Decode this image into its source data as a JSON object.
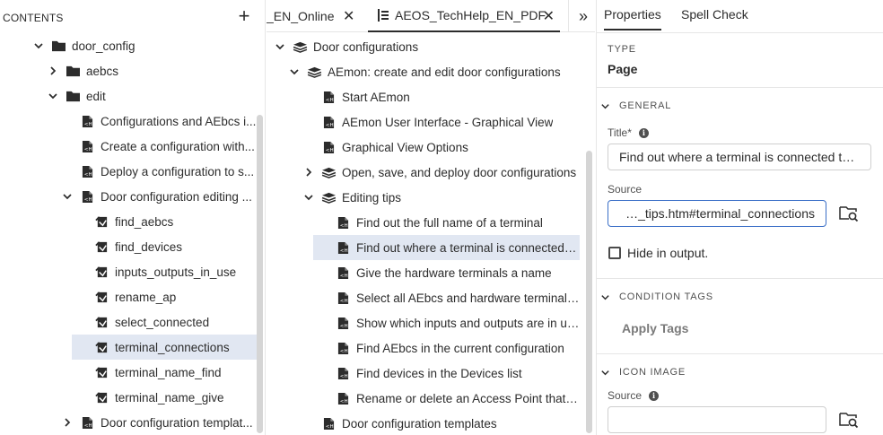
{
  "left": {
    "title": "CONTENTS",
    "add_label": "+",
    "tree": [
      {
        "label": "door_config",
        "kind": "folder",
        "state": "open",
        "level": 0
      },
      {
        "label": "aebcs",
        "kind": "folder",
        "state": "closed",
        "level": 1
      },
      {
        "label": "edit",
        "kind": "folder",
        "state": "open",
        "level": 1
      },
      {
        "label": "Configurations and AEbcs i...",
        "kind": "topic",
        "state": "none",
        "level": 2
      },
      {
        "label": "Create a configuration with...",
        "kind": "topic",
        "state": "none",
        "level": 2
      },
      {
        "label": "Deploy a configuration to s...",
        "kind": "topic",
        "state": "none",
        "level": 2
      },
      {
        "label": "Door configuration editing ...",
        "kind": "topic",
        "state": "open",
        "level": 2
      },
      {
        "label": "find_aebcs",
        "kind": "snippet",
        "state": "none",
        "level": 3
      },
      {
        "label": "find_devices",
        "kind": "snippet",
        "state": "none",
        "level": 3
      },
      {
        "label": "inputs_outputs_in_use",
        "kind": "snippet",
        "state": "none",
        "level": 3
      },
      {
        "label": "rename_ap",
        "kind": "snippet",
        "state": "none",
        "level": 3
      },
      {
        "label": "select_connected",
        "kind": "snippet",
        "state": "none",
        "level": 3
      },
      {
        "label": "terminal_connections",
        "kind": "snippet",
        "state": "none",
        "level": 3,
        "selected": true
      },
      {
        "label": "terminal_name_find",
        "kind": "snippet",
        "state": "none",
        "level": 3
      },
      {
        "label": "terminal_name_give",
        "kind": "snippet",
        "state": "none",
        "level": 3
      },
      {
        "label": "Door configuration templat...",
        "kind": "topic",
        "state": "closed",
        "level": 2
      }
    ]
  },
  "mid": {
    "tab_online_label": "_EN_Online",
    "tab_pdf_label": "AEOS_TechHelp_EN_PDF",
    "close_glyph": "✕",
    "more_glyph": "»",
    "tree": [
      {
        "label": "Door configurations",
        "kind": "book",
        "state": "open",
        "level": 0
      },
      {
        "label": "AEmon: create and edit door configurations",
        "kind": "book",
        "state": "open",
        "level": 1
      },
      {
        "label": "Start AEmon",
        "kind": "topic",
        "state": "none",
        "level": 2
      },
      {
        "label": "AEmon User Interface - Graphical View",
        "kind": "topic",
        "state": "none",
        "level": 2
      },
      {
        "label": "Graphical View Options",
        "kind": "topic",
        "state": "none",
        "level": 2
      },
      {
        "label": "Open, save, and deploy door configurations",
        "kind": "book",
        "state": "closed",
        "level": 2
      },
      {
        "label": "Editing tips",
        "kind": "book",
        "state": "open",
        "level": 2
      },
      {
        "label": "Find out the full name of a terminal",
        "kind": "topic",
        "state": "none",
        "level": 3
      },
      {
        "label": "Find out where a terminal is connected to ...",
        "kind": "topic",
        "state": "none",
        "level": 3,
        "selected": true
      },
      {
        "label": "Give the hardware terminals a name",
        "kind": "topic",
        "state": "none",
        "level": 3
      },
      {
        "label": "Select all AEbcs and hardware terminals t...",
        "kind": "topic",
        "state": "none",
        "level": 3
      },
      {
        "label": "Show which inputs and outputs are in use...",
        "kind": "topic",
        "state": "none",
        "level": 3
      },
      {
        "label": "Find AEbcs in the current configuration",
        "kind": "topic",
        "state": "none",
        "level": 3
      },
      {
        "label": "Find devices in the Devices list",
        "kind": "topic",
        "state": "none",
        "level": 3
      },
      {
        "label": "Rename or delete an Access Point that is i...",
        "kind": "topic",
        "state": "none",
        "level": 3
      },
      {
        "label": "Door configuration templates",
        "kind": "topic",
        "state": "none",
        "level": 2
      }
    ]
  },
  "right": {
    "tab_properties": "Properties",
    "tab_spell_check": "Spell Check",
    "type_label": "TYPE",
    "type_value": "Page",
    "general_label": "GENERAL",
    "title_label": "Title*",
    "title_value": "Find out where a terminal is connected to in ...",
    "source_label": "Source",
    "source_value": "editing_tips.htm#terminal_connections",
    "hide_label": "Hide in output.",
    "condition_tags_label": "CONDITION TAGS",
    "apply_tags_label": "Apply Tags",
    "icon_image_label": "ICON IMAGE",
    "icon_source_label": "Source",
    "icon_source_value": ""
  },
  "colors": {
    "selection": "#e1e7f2",
    "focus_border": "#3b6fc7",
    "text": "#2c2c2c"
  }
}
